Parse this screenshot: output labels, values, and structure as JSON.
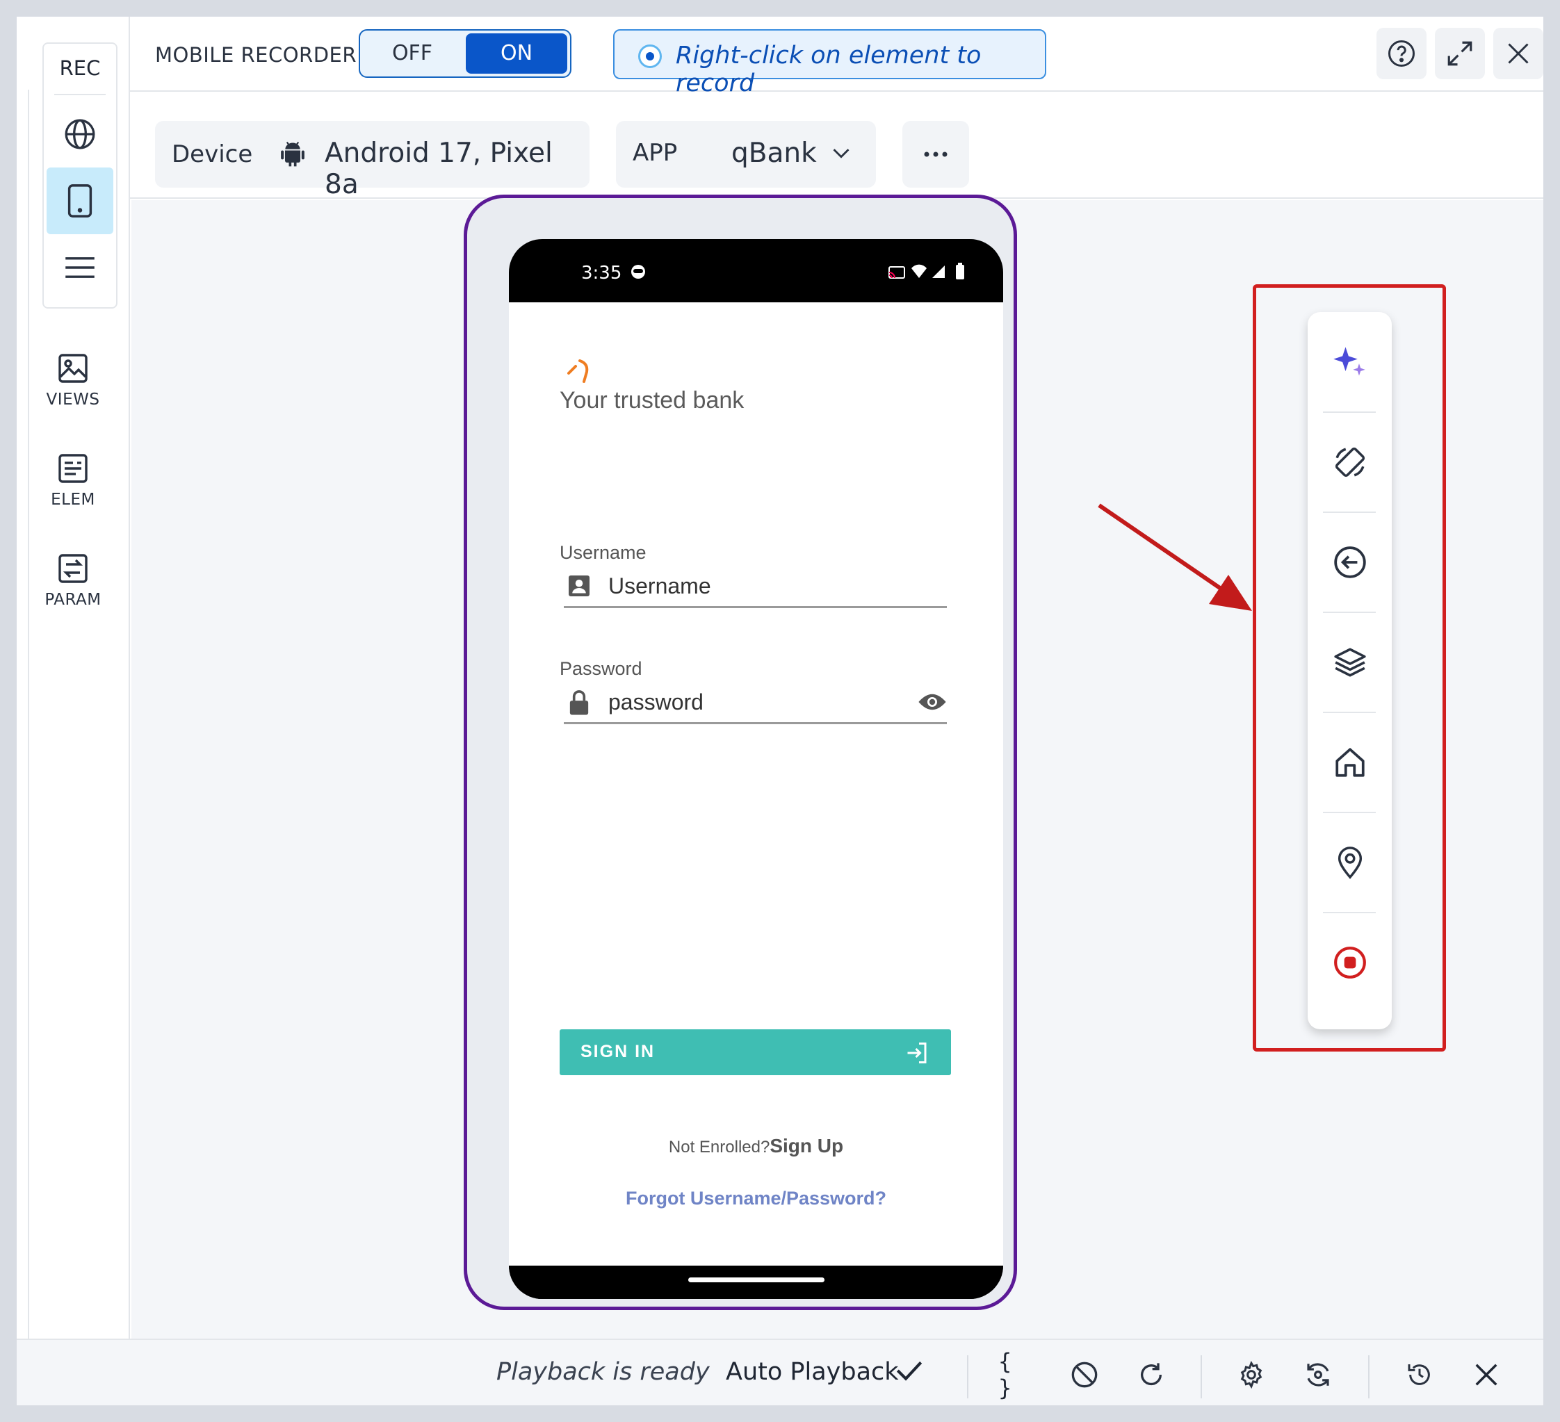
{
  "left_rail": {
    "rec_label": "REC",
    "tools": [
      {
        "label": "VIEWS"
      },
      {
        "label": "ELEM"
      },
      {
        "label": "PARAM"
      }
    ]
  },
  "top_bar": {
    "recorder_label": "MOBILE RECORDER",
    "toggle_off": "OFF",
    "toggle_on": "ON",
    "hint": "Right-click on element to record"
  },
  "device_bar": {
    "device_label": "Device",
    "device_value": "Android 17, Pixel 8a",
    "app_label": "APP",
    "app_value": "qBank"
  },
  "phone": {
    "status_time": "3:35",
    "tagline": "Your trusted bank",
    "username_label": "Username",
    "username_placeholder": "Username",
    "password_label": "Password",
    "password_placeholder": "password",
    "signin_label": "SIGN IN",
    "enroll_text": "Not Enrolled?",
    "signup_link": "Sign Up",
    "forgot_link": "Forgot Username/Password?"
  },
  "bottom_bar": {
    "playback_status": "Playback is ready",
    "auto_playback": "Auto Playback",
    "braces": "{ }"
  },
  "colors": {
    "accent": "#0a56c9",
    "device_frame": "#5b1a96",
    "highlight": "#d11f1f",
    "signin": "#3fbeb3",
    "rail_active": "#c8ebfb"
  }
}
